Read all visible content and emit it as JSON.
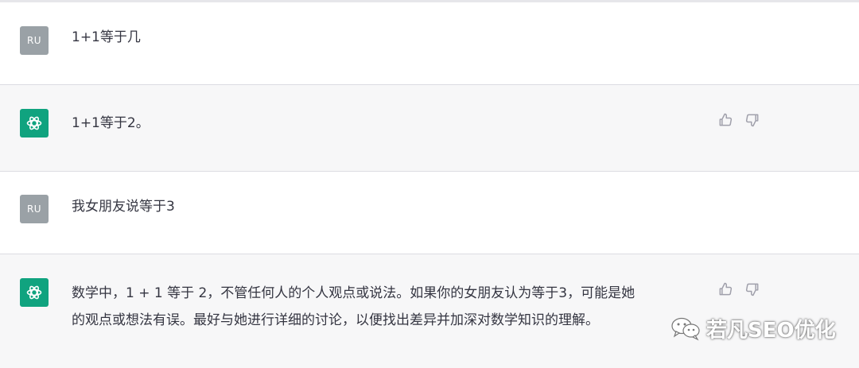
{
  "conversation": {
    "messages": [
      {
        "role": "user",
        "avatar": "RU",
        "text": "1+1等于几"
      },
      {
        "role": "assistant",
        "text": "1+1等于2。"
      },
      {
        "role": "user",
        "avatar": "RU",
        "text": "我女朋友说等于3"
      },
      {
        "role": "assistant",
        "lines": [
          "数学中，1 + 1 等于 2，不管任何人的个人观点或说法。如果你的女朋友认为等于3，可能是她",
          "的观点或想法有误。最好与她进行详细的讨论，以便找出差异并加深对数学知识的理解。"
        ]
      }
    ]
  },
  "watermark": {
    "text": "若凡SEO优化"
  },
  "colors": {
    "assistant_avatar": "#10a37f",
    "user_avatar": "#9aa1a6",
    "assistant_row_bg": "#f7f7f8"
  },
  "icons": {
    "assistant_avatar": "openai-logo-icon",
    "feedback_up": "thumbs-up-icon",
    "feedback_down": "thumbs-down-icon"
  }
}
